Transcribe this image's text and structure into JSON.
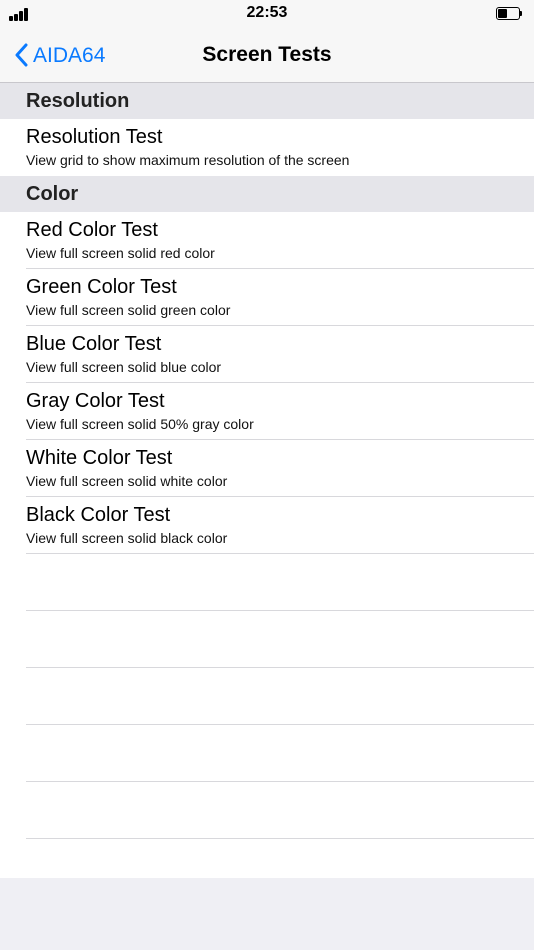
{
  "status_bar": {
    "time": "22:53",
    "icons": [
      "signal-icon",
      "battery-icon"
    ]
  },
  "nav": {
    "back_label": "AIDA64",
    "title": "Screen Tests",
    "back_icon": "chevron-left-icon",
    "accent_color": "#0a7aff"
  },
  "sections": [
    {
      "header": "Resolution",
      "items": [
        {
          "title": "Resolution Test",
          "subtitle": "View grid to show maximum resolution of the screen"
        }
      ]
    },
    {
      "header": "Color",
      "items": [
        {
          "title": "Red Color Test",
          "subtitle": "View full screen solid red color"
        },
        {
          "title": "Green Color Test",
          "subtitle": "View full screen solid green color"
        },
        {
          "title": "Blue Color Test",
          "subtitle": "View full screen solid blue color"
        },
        {
          "title": "Gray Color Test",
          "subtitle": "View full screen solid 50% gray color"
        },
        {
          "title": "White Color Test",
          "subtitle": "View full screen solid white color"
        },
        {
          "title": "Black Color Test",
          "subtitle": "View full screen solid black color"
        }
      ]
    }
  ]
}
